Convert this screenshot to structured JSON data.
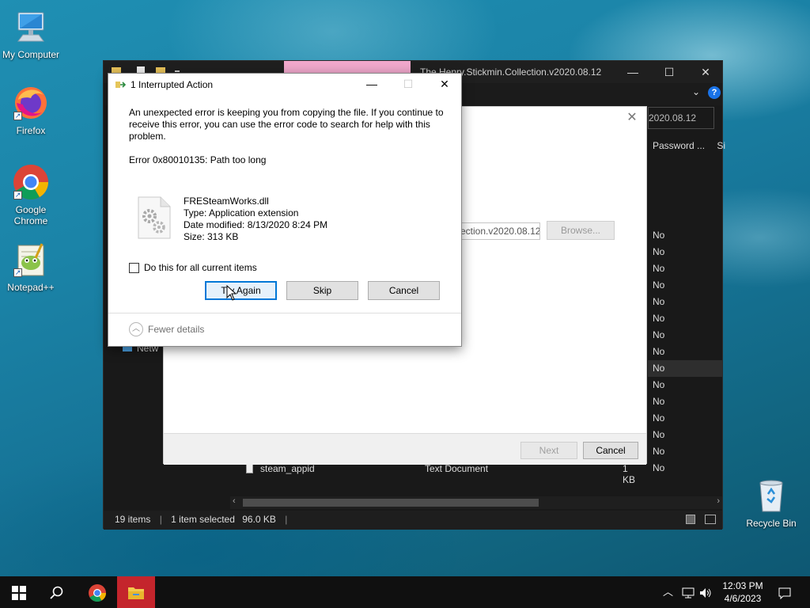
{
  "desktop": {
    "icons": [
      {
        "label": "My Computer"
      },
      {
        "label": "Firefox"
      },
      {
        "label": "Google Chrome"
      },
      {
        "label": "Notepad++"
      },
      {
        "label": "Recycle Bin"
      }
    ]
  },
  "explorer": {
    "title": "The.Henry.Stickmin.Collection.v2020.08.12",
    "search_value": "2020.08.12",
    "column_password": "Password ...",
    "column_size_partial": "Si",
    "password_values": [
      "No",
      "No",
      "No",
      "No",
      "No",
      "No",
      "No",
      "No",
      "No",
      "No",
      "No",
      "No",
      "No",
      "No",
      "No"
    ],
    "last_row": {
      "name": "steam_appid",
      "type": "Text Document",
      "size": "1 KB"
    },
    "nav_network": "Netw",
    "status": {
      "items": "19 items",
      "selected": "1 item selected",
      "size": "96.0 KB"
    }
  },
  "wizard": {
    "path_value": "ection.v2020.08.12",
    "browse_label": "Browse...",
    "next_label": "Next",
    "cancel_label": "Cancel"
  },
  "dialog": {
    "title": "1 Interrupted Action",
    "message": "An unexpected error is keeping you from copying the file. If you continue to receive this error, you can use the error code to search for help with this problem.",
    "error": "Error 0x80010135: Path too long",
    "file": {
      "name": "FRESteamWorks.dll",
      "type": "Type: Application extension",
      "modified": "Date modified: 8/13/2020 8:24 PM",
      "size": "Size: 313 KB"
    },
    "checkbox_label": "Do this for all current items",
    "buttons": {
      "try_again": "Try Again",
      "skip": "Skip",
      "cancel": "Cancel"
    },
    "fewer_details": "Fewer details"
  },
  "taskbar": {
    "time": "12:03 PM",
    "date": "4/6/2023"
  },
  "colors": {
    "accent": "#0078d7",
    "explorer_active": "#c4252c"
  }
}
